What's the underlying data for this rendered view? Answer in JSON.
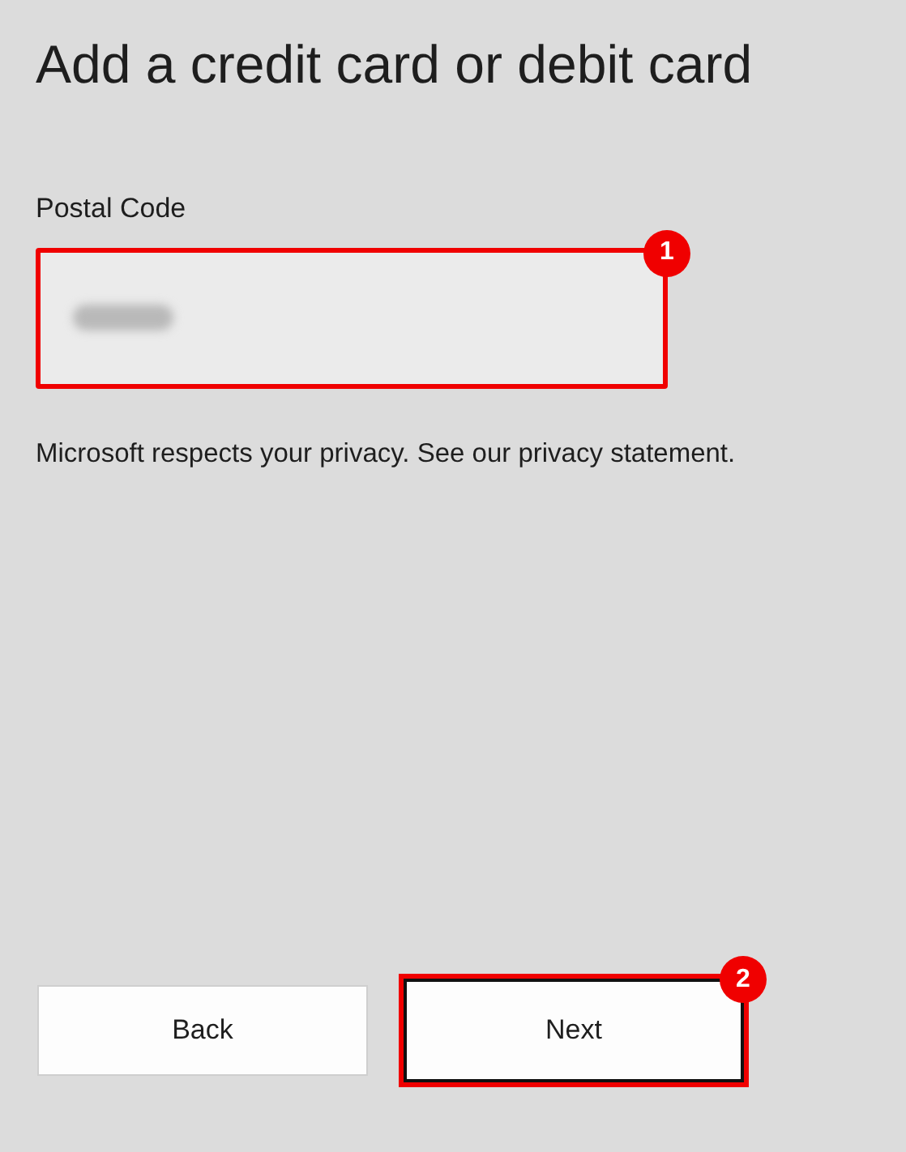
{
  "title": "Add a credit card or debit card",
  "postal_code": {
    "label": "Postal Code",
    "value_blurred": true,
    "highlighted": true,
    "step": "1"
  },
  "privacy_text": "Microsoft respects your privacy. See our privacy statement.",
  "buttons": [
    {
      "label": "Back",
      "focused": false,
      "highlighted": false
    },
    {
      "label": "Next",
      "focused": true,
      "highlighted": true,
      "step": "2"
    }
  ]
}
